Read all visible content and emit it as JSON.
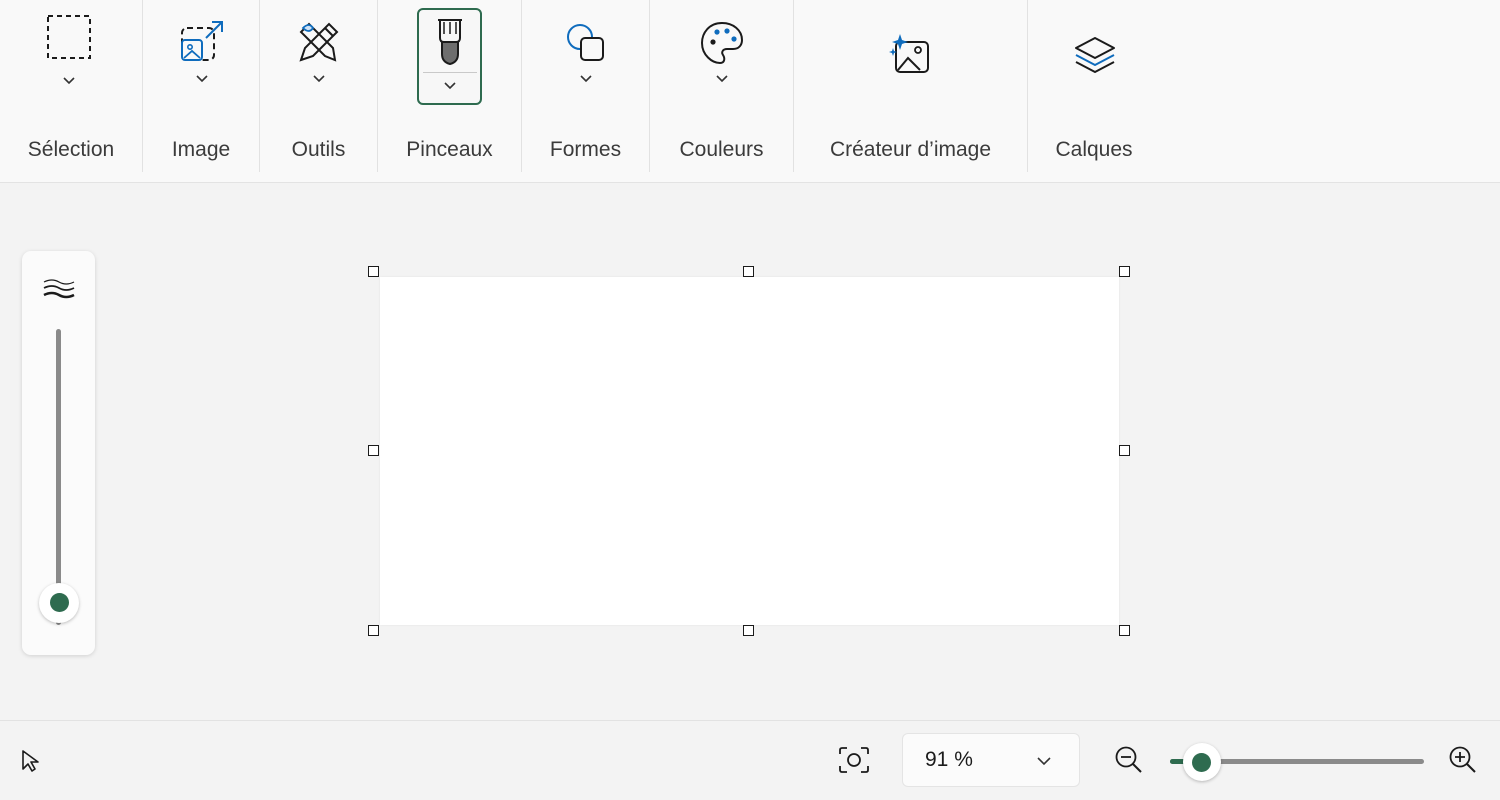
{
  "ribbon": {
    "groups": [
      {
        "label": "Sélection"
      },
      {
        "label": "Image"
      },
      {
        "label": "Outils"
      },
      {
        "label": "Pinceaux"
      },
      {
        "label": "Formes"
      },
      {
        "label": "Couleurs"
      },
      {
        "label": "Créateur d’image"
      },
      {
        "label": "Calques"
      }
    ],
    "active_group": "Pinceaux"
  },
  "brush_size": {
    "level": 0.03
  },
  "statusbar": {
    "zoom_value": "91 %",
    "zoom_slider_level": 0.1
  },
  "colors": {
    "accent": "#2e6b4f",
    "icon_blue": "#0f6cbd"
  },
  "icons": {
    "selection": "dashed-rectangle-icon",
    "image": "image-resize-icon",
    "tools": "pencil-tools-icon",
    "brushes": "brush-icon",
    "shapes": "shapes-icon",
    "colors": "palette-icon",
    "image_creator": "sparkle-image-icon",
    "layers": "layers-icon",
    "brush_size": "stroke-width-icon",
    "pointer": "cursor-pointer-icon",
    "fit": "fit-to-window-icon",
    "zoom_out": "zoom-out-icon",
    "zoom_in": "zoom-in-icon"
  }
}
